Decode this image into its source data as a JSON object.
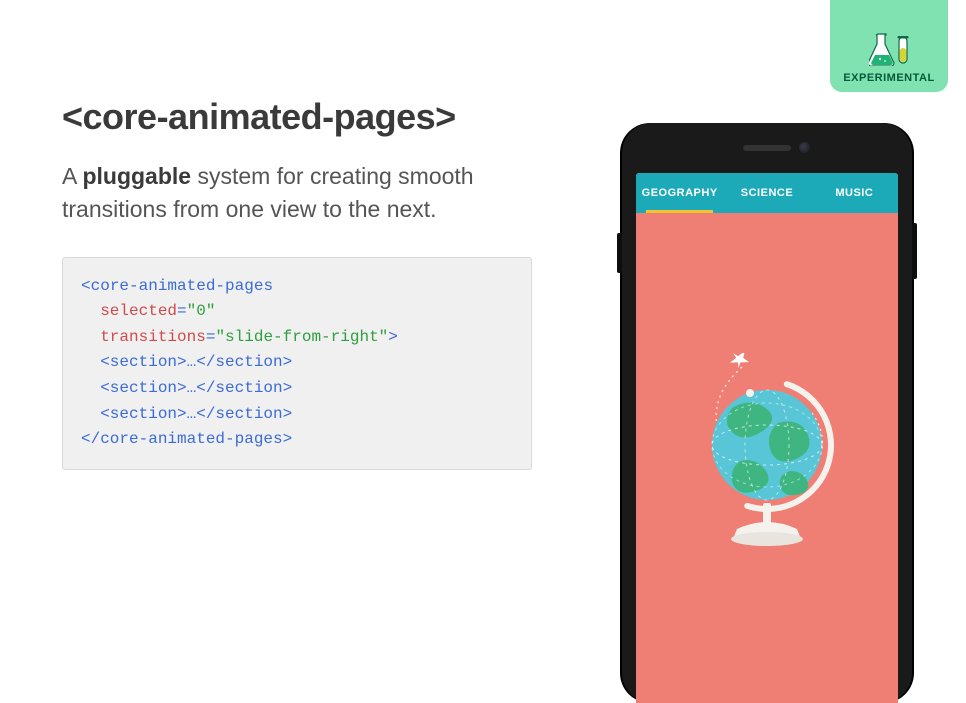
{
  "badge": {
    "label": "EXPERIMENTAL"
  },
  "title": "<core-animated-pages>",
  "subtitle": {
    "before": "A ",
    "bold": "pluggable",
    "after": " system for creating smooth transitions from one view to the next."
  },
  "code": {
    "open_tag": "core-animated-pages",
    "attr1_name": "selected",
    "attr1_val": "\"0\"",
    "attr2_name": "transitions",
    "attr2_val": "\"slide-from-right\"",
    "section_line": "  <section>…</section>",
    "close_tag": "</core-animated-pages>"
  },
  "phone": {
    "tabs": [
      "GEOGRAPHY",
      "SCIENCE",
      "MUSIC"
    ],
    "active_tab_index": 0
  },
  "colors": {
    "badge_bg": "#80e2b1",
    "tabbar_bg": "#1ca9b8",
    "screen_bg": "#ef7e74",
    "indicator": "#f4c330"
  }
}
